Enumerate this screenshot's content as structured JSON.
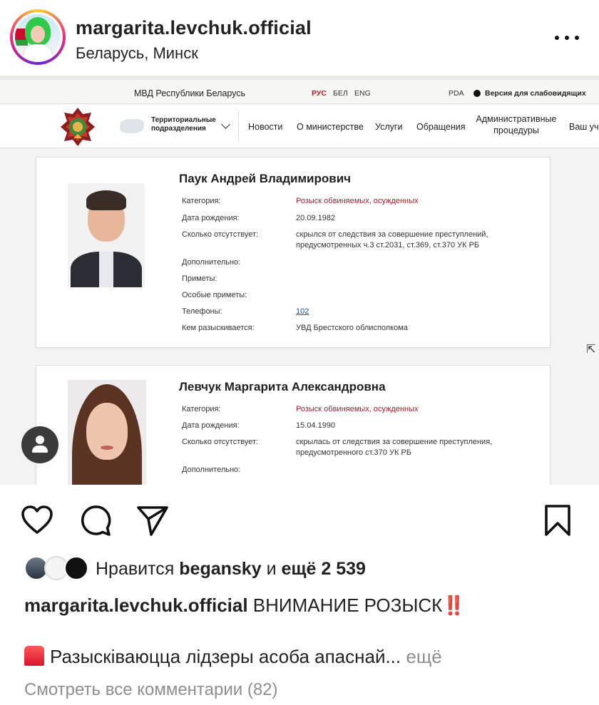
{
  "post": {
    "username": "margarita.levchuk.official",
    "location": "Беларусь, Минск"
  },
  "site": {
    "title": "МВД Республики Беларусь",
    "lang_rus": "РУС",
    "lang_bel": "БЕЛ",
    "lang_eng": "ENG",
    "pda": "PDA",
    "vision": "Версия для слабовидящих",
    "territorial": "Территориальные\nподразделения",
    "nav": [
      "Новости",
      "О министерстве",
      "Услуги",
      "Обращения",
      "Административные процедуры",
      "Ваш уча"
    ]
  },
  "labels": {
    "category": "Категория:",
    "birth": "Дата рождения:",
    "absent": "Сколько отсутствует:",
    "extra": "Дополнительно:",
    "signs": "Приметы:",
    "special": "Особые приметы:",
    "phones": "Телефоны:",
    "searched_by": "Кем разыскивается:"
  },
  "persons": [
    {
      "name": "Паук Андрей Владимирович",
      "category": "Розыск обвиняемых, осужденных",
      "birth": "20.09.1982",
      "absent_1": "скрылся от следствия за совершение преступлений,",
      "absent_2": "предусмотренных ч.3 ст.2031, ст.369, ст.370 УК РБ",
      "phones": "102",
      "searched_by": "УВД Брестского облисполкома"
    },
    {
      "name": "Левчук Маргарита Александровна",
      "category": "Розыск обвиняемых, осужденных",
      "birth": "15.04.1990",
      "absent_1": "скрылась от следствия за совершение преступления,",
      "absent_2": "предусмотренного ст.370 УК РБ"
    }
  ],
  "likes": {
    "prefix": "Нравится",
    "user": "beganskу",
    "middle": "и",
    "count": "ещё 2 539"
  },
  "caption": {
    "username": "margarita.levchuk.official",
    "text": "ВНИМАНИЕ РОЗЫСК",
    "emoji": "‼️",
    "line2": "Разыскiваюцца лiдзеры асоба апаснай...",
    "more": "ещё"
  },
  "comments": "Смотреть все комментарии (82)",
  "icons": {
    "more": "more-dots-icon",
    "heart": "heart-icon",
    "comment": "comment-icon",
    "share": "send-icon",
    "save": "bookmark-icon"
  }
}
